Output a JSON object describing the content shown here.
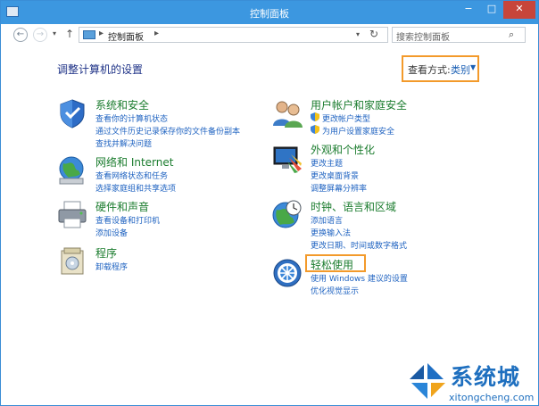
{
  "window": {
    "title": "控制面板"
  },
  "window_buttons": {
    "minimize": "−",
    "maximize": "□",
    "close": "✕"
  },
  "nav": {
    "back_icon": "←",
    "forward_icon": "→",
    "recent_icon": "▾",
    "up_icon": "↑",
    "address_sep": "▸",
    "address_text": "控制面板",
    "address_sep2": "▸",
    "address_drop": "▾",
    "refresh_icon": "↻",
    "search_placeholder": "搜索控制面板",
    "search_icon": "⌕"
  },
  "main": {
    "heading": "调整计算机的设置",
    "view_label": "查看方式:",
    "view_value": "类别",
    "view_caret": "▼"
  },
  "categories": [
    {
      "title": "系统和安全",
      "links": [
        "查看你的计算机状态",
        "通过文件历史记录保存你的文件备份副本",
        "查找并解决问题"
      ]
    },
    {
      "title": "网络和 Internet",
      "links": [
        "查看网络状态和任务",
        "选择家庭组和共享选项"
      ]
    },
    {
      "title": "硬件和声音",
      "links": [
        "查看设备和打印机",
        "添加设备"
      ]
    },
    {
      "title": "程序",
      "links": [
        "卸载程序"
      ]
    },
    {
      "title": "用户帐户和家庭安全",
      "links": [
        "更改帐户类型",
        "为用户设置家庭安全"
      ]
    },
    {
      "title": "外观和个性化",
      "links": [
        "更改主题",
        "更改桌面背景",
        "调整屏幕分辨率"
      ]
    },
    {
      "title": "时钟、语言和区域",
      "links": [
        "添加语言",
        "更换输入法",
        "更改日期、时间或数字格式"
      ]
    },
    {
      "title": "轻松使用",
      "links": [
        "使用 Windows 建议的设置",
        "优化视觉显示"
      ]
    }
  ],
  "watermark": {
    "brand": "系统城",
    "url": "xitongcheng.com"
  },
  "colors": {
    "accent": "#3c97e0",
    "highlight_box": "#f39a2b",
    "link": "#1f63c1",
    "category_title": "#1b7c2e"
  }
}
